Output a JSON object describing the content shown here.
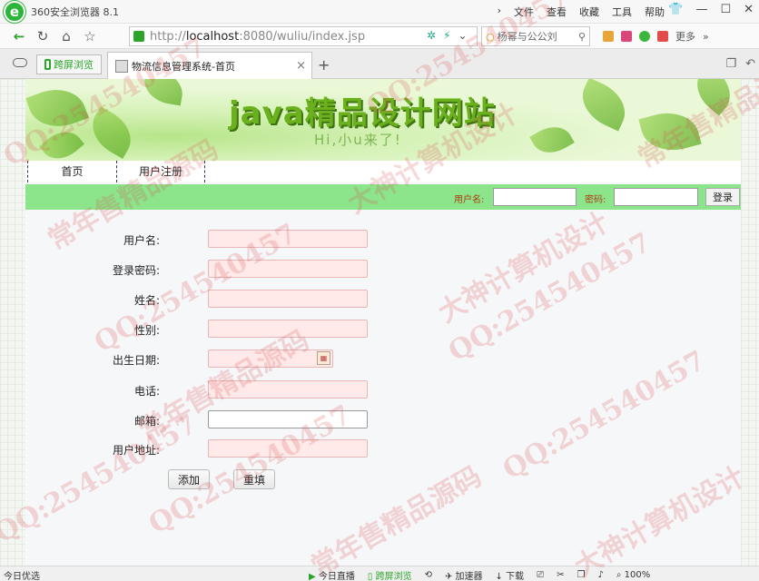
{
  "browser": {
    "title": "360安全浏览器 8.1",
    "menus": [
      "文件",
      "查看",
      "收藏",
      "工具",
      "帮助"
    ],
    "url_prefix": "http://",
    "url_host": "localhost",
    "url_rest": ":8080/wuliu/index.jsp",
    "search_text": "杨幂与公公刘",
    "more_label": "更多"
  },
  "tabs": {
    "split_label": "跨屏浏览",
    "active_title": "物流信息管理系统-首页"
  },
  "page": {
    "site_title": "java精品设计网站",
    "site_subtitle": "Hi,小u来了!",
    "nav": [
      "首页",
      "用户注册"
    ],
    "login": {
      "username_label": "用户名:",
      "password_label": "密码:",
      "login_button": "登录",
      "username_value": "",
      "password_value": ""
    },
    "form": {
      "fields": [
        {
          "label": "用户名:",
          "value": ""
        },
        {
          "label": "登录密码:",
          "value": ""
        },
        {
          "label": "姓名:",
          "value": ""
        },
        {
          "label": "性别:",
          "value": ""
        },
        {
          "label": "出生日期:",
          "value": ""
        },
        {
          "label": "电话:",
          "value": ""
        },
        {
          "label": "邮箱:",
          "value": ""
        },
        {
          "label": "用户地址:",
          "value": ""
        }
      ],
      "submit_label": "添加",
      "reset_label": "重填"
    }
  },
  "statusbar": {
    "left": "今日优选",
    "live": "今日直播",
    "split": "跨屏浏览",
    "accelerator": "加速器",
    "download": "下载",
    "zoom": "100%"
  },
  "watermarks": {
    "qq": "QQ:254540457",
    "seller": "常年售精品源码",
    "designer": "大神计算机设计"
  },
  "colors": {
    "login_bar": "#8ce58a",
    "title_green": "#6bb11e",
    "input_pink": "#ffe9e9"
  }
}
